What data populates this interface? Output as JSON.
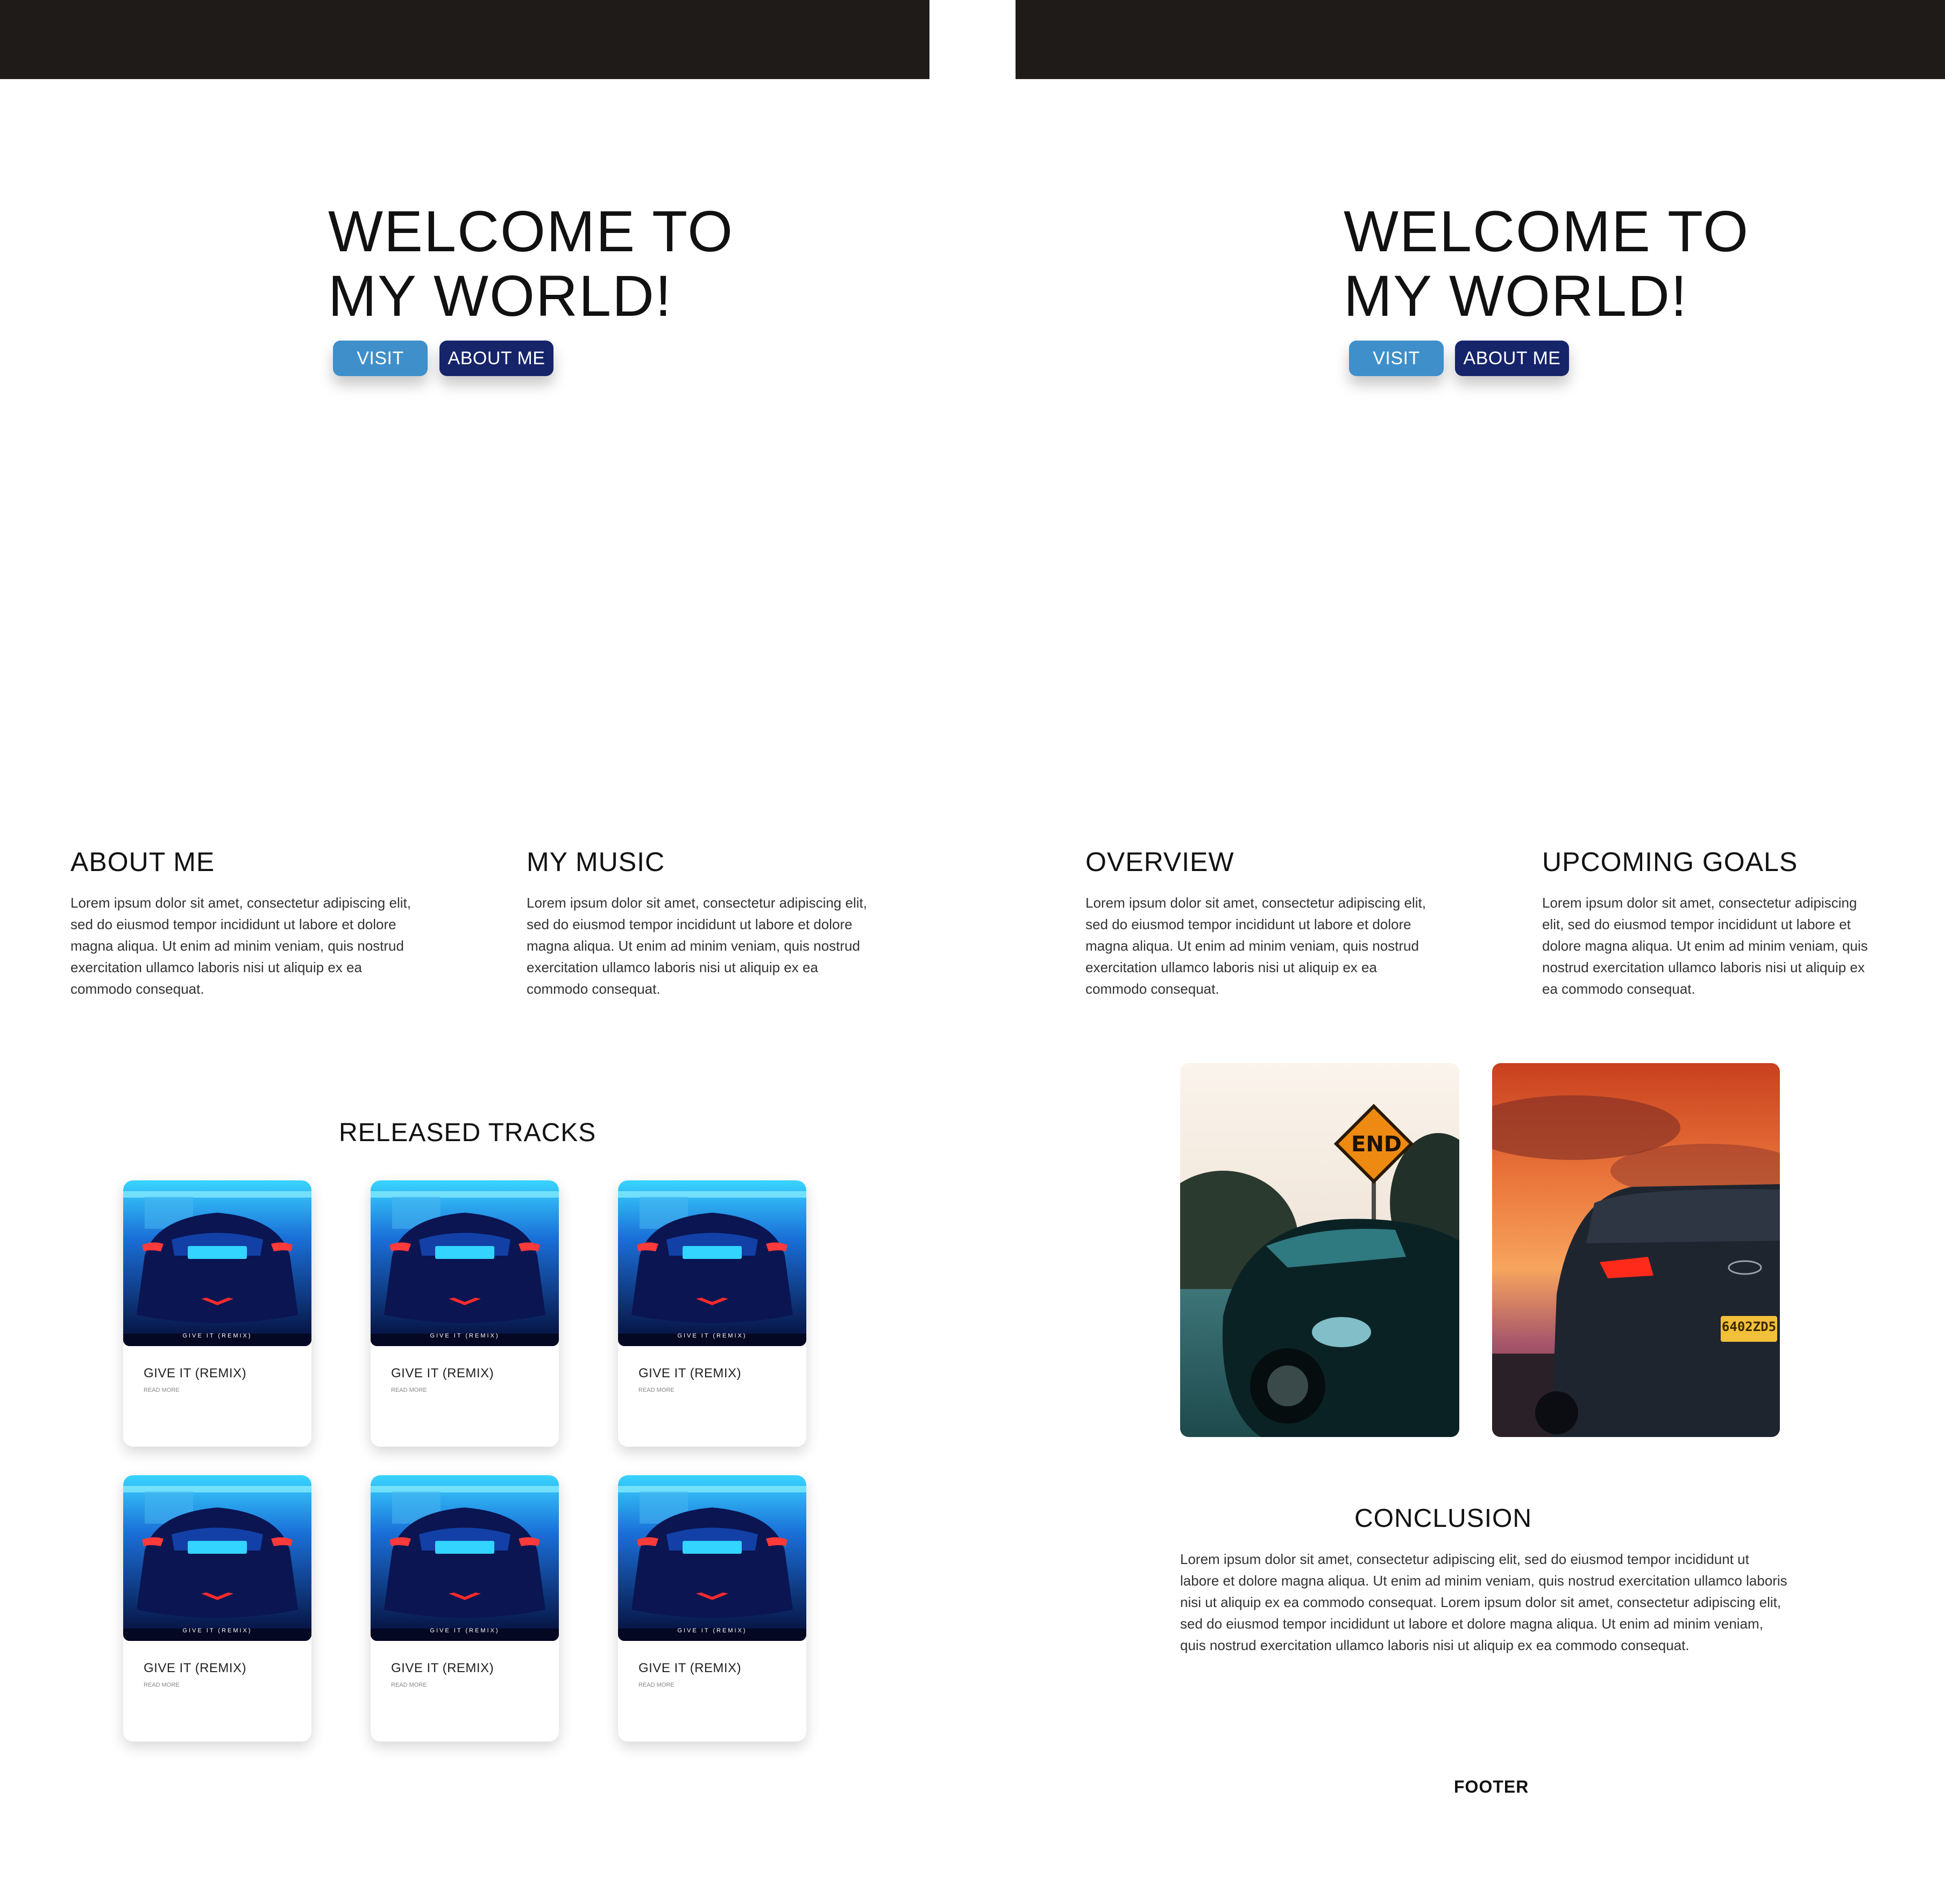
{
  "colors": {
    "topbar": "#1f1b19",
    "visit_button": "#3f8fcb",
    "about_button": "#16246a",
    "text": "#111111"
  },
  "hero": {
    "title_line1": "WELCOME TO",
    "title_line2": "MY WORLD!",
    "visit_label": "VISIT",
    "about_label": "ABOUT ME"
  },
  "sections": {
    "about": {
      "title": "ABOUT ME",
      "text": "Lorem ipsum dolor sit amet, consectetur adipiscing elit, sed do eiusmod tempor incididunt ut labore et dolore magna aliqua. Ut enim ad minim veniam, quis nostrud exercitation ullamco laboris nisi ut aliquip ex ea commodo consequat."
    },
    "music": {
      "title": "MY MUSIC",
      "text": "Lorem ipsum dolor sit amet, consectetur adipiscing elit, sed do eiusmod tempor incididunt ut labore et dolore magna aliqua. Ut enim ad minim veniam, quis nostrud exercitation ullamco laboris nisi ut aliquip ex ea commodo consequat."
    },
    "overview": {
      "title": "OVERVIEW",
      "text": "Lorem ipsum dolor sit amet, consectetur adipiscing elit, sed do eiusmod tempor incididunt ut labore et dolore magna aliqua. Ut enim ad minim veniam, quis nostrud exercitation ullamco laboris nisi ut aliquip ex ea commodo consequat."
    },
    "goals": {
      "title": "UPCOMING GOALS",
      "text": "Lorem ipsum dolor sit amet, consectetur adipiscing elit, sed do eiusmod tempor incididunt ut labore et dolore magna aliqua. Ut enim ad minim veniam, quis nostrud exercitation ullamco laboris nisi ut aliquip ex ea commodo consequat."
    }
  },
  "tracks": {
    "title": "RELEASED TRACKS",
    "cover_caption": "GIVE IT (REMIX)",
    "items": [
      {
        "title": "GIVE IT (REMIX)",
        "link": "READ MORE"
      },
      {
        "title": "GIVE IT (REMIX)",
        "link": "READ MORE"
      },
      {
        "title": "GIVE IT (REMIX)",
        "link": "READ MORE"
      },
      {
        "title": "GIVE IT (REMIX)",
        "link": "READ MORE"
      },
      {
        "title": "GIVE IT (REMIX)",
        "link": "READ MORE"
      },
      {
        "title": "GIVE IT (REMIX)",
        "link": "READ MORE"
      }
    ]
  },
  "photos": {
    "sign_text": "END",
    "plate_text": "6402ZD5"
  },
  "conclusion": {
    "title": "CONCLUSION",
    "text": "Lorem ipsum dolor sit amet, consectetur adipiscing elit, sed do eiusmod tempor incididunt ut labore et dolore magna aliqua. Ut enim ad minim veniam, quis nostrud exercitation ullamco laboris nisi ut aliquip ex ea commodo consequat.  Lorem ipsum dolor sit amet, consectetur adipiscing elit, sed do eiusmod tempor incididunt ut labore et dolore magna aliqua. Ut enim ad minim veniam, quis nostrud exercitation ullamco laboris nisi ut aliquip ex ea commodo consequat."
  },
  "footer": {
    "label": "FOOTER"
  }
}
